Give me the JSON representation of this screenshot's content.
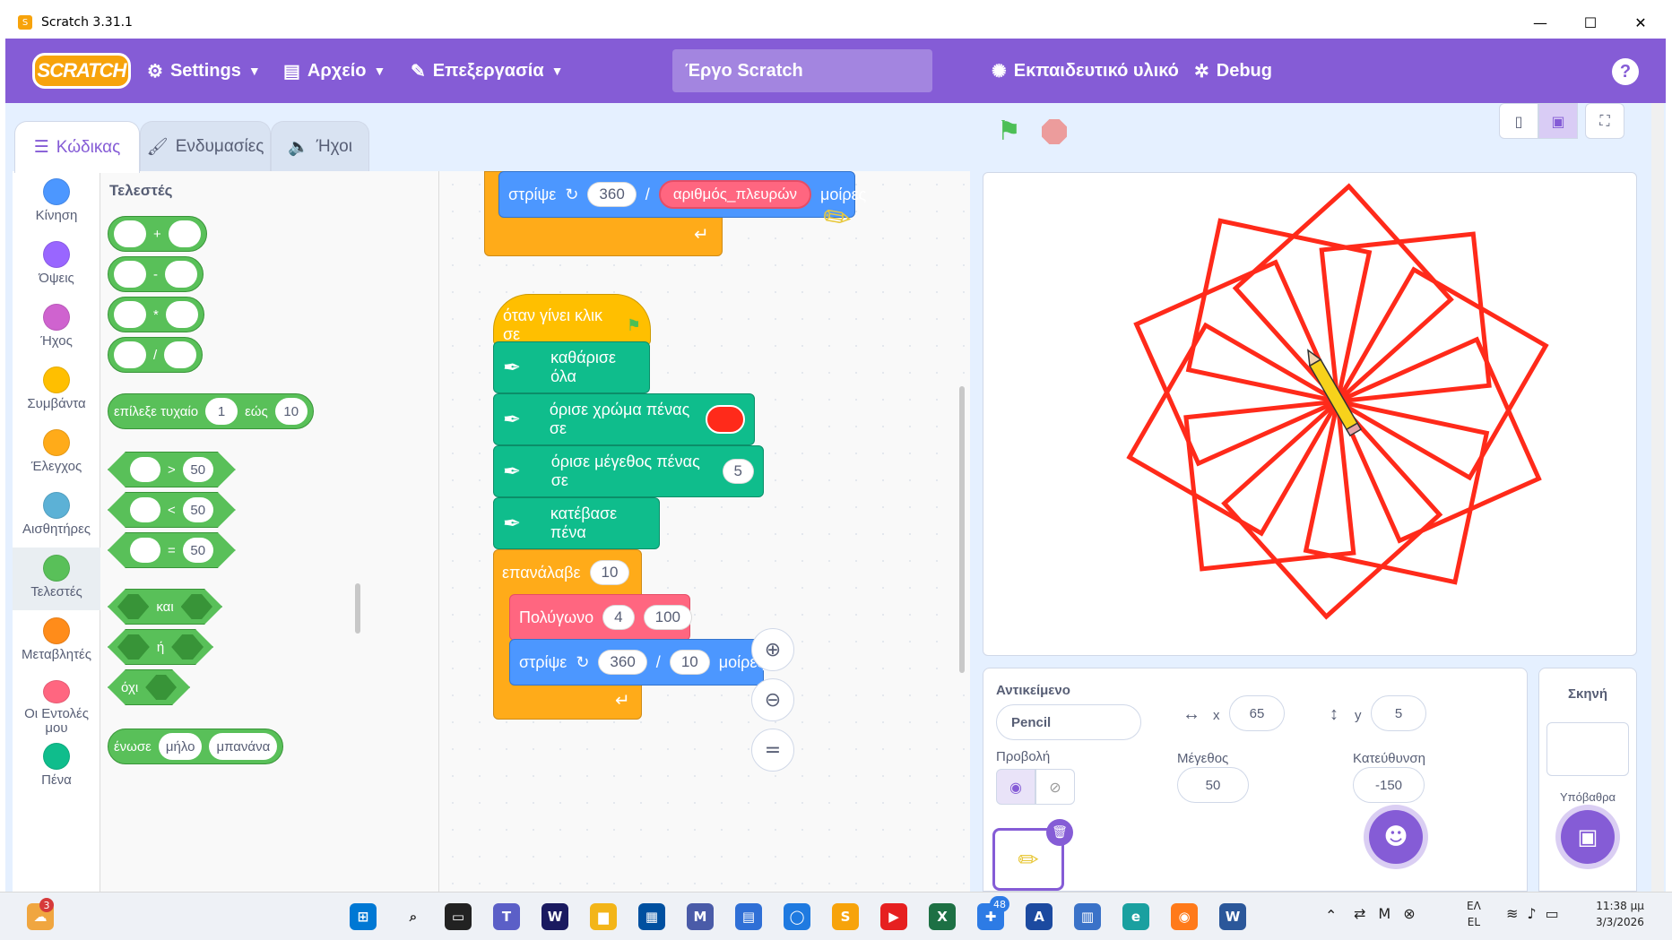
{
  "window": {
    "title": "Scratch 3.31.1"
  },
  "menu": {
    "logo": "SCRATCH",
    "settings": "Settings",
    "file": "Αρχείο",
    "edit": "Επεξεργασία",
    "project_title": "Έργο Scratch",
    "tutorials": "Εκπαιδευτικό υλικό",
    "debug": "Debug",
    "help": "?"
  },
  "tabs": {
    "code": "Κώδικας",
    "costumes": "Ενδυμασίες",
    "sounds": "Ήχοι"
  },
  "categories": [
    {
      "label": "Κίνηση",
      "color": "#4c97ff"
    },
    {
      "label": "Όψεις",
      "color": "#9966ff"
    },
    {
      "label": "Ήχος",
      "color": "#cf63cf"
    },
    {
      "label": "Συμβάντα",
      "color": "#ffbf00"
    },
    {
      "label": "Έλεγχος",
      "color": "#ffab19"
    },
    {
      "label": "Αισθητήρες",
      "color": "#5cb1d6"
    },
    {
      "label": "Τελεστές",
      "color": "#59c059"
    },
    {
      "label": "Μεταβλητές",
      "color": "#ff8c1a"
    },
    {
      "label": "Οι Εντολές μου",
      "color": "#ff6680"
    },
    {
      "label": "Πένα",
      "color": "#0fbd8c"
    }
  ],
  "palette": {
    "heading": "Τελεστές",
    "ops": [
      "+",
      "-",
      "*",
      "/"
    ],
    "random": {
      "label": "επίλεξε τυχαίο",
      "from": "1",
      "to_label": "εώς",
      "to": "10"
    },
    "compare": [
      {
        "op": ">",
        "value": "50"
      },
      {
        "op": "<",
        "value": "50"
      },
      {
        "op": "=",
        "value": "50"
      }
    ],
    "logic": [
      "και",
      "ή",
      "όχι"
    ],
    "join": {
      "label": "ένωσε",
      "a": "μήλο",
      "b": "μπανάνα"
    }
  },
  "script": {
    "top_turn": {
      "label": "στρίψε",
      "a": "360",
      "div": "/",
      "var": "αριθμός_πλευρών",
      "unit": "μοίρες"
    },
    "hat": "όταν γίνει κλικ σε",
    "clear": "καθάρισε όλα",
    "pen_color": "όρισε χρώμα πένας σε",
    "pen_size": {
      "label": "όρισε μέγεθος πένας σε",
      "value": "5"
    },
    "pen_down": "κατέβασε πένα",
    "repeat": {
      "label": "επανάλαβε",
      "value": "10"
    },
    "polygon": {
      "label": "Πολύγωνο",
      "a": "4",
      "b": "100"
    },
    "turn": {
      "label": "στρίψε",
      "a": "360",
      "div": "/",
      "b": "10",
      "unit": "μοίρες"
    }
  },
  "sprite": {
    "label_sprite": "Αντικείμενο",
    "name": "Pencil",
    "x_label": "x",
    "x": "65",
    "y_label": "y",
    "y": "5",
    "show_label": "Προβολή",
    "size_label": "Μέγεθος",
    "size": "50",
    "direction_label": "Κατεύθυνση",
    "direction": "-150"
  },
  "stage_panel": {
    "title": "Σκηνή",
    "backdrops": "Υπόβαθρα"
  },
  "taskbar": {
    "weather_badge": "3",
    "badge_48": "48",
    "lang": "ΕΛ",
    "lang2": "EL",
    "time": "11:38 μμ",
    "date": "3/3/2026"
  },
  "colors": {
    "accent": "#855cd6",
    "operators": "#59c059",
    "pen": "#0fbd8c",
    "control": "#ffab19",
    "events": "#ffbf00",
    "motion": "#4c97ff",
    "myblocks": "#ff6680",
    "drawing": "#ff2a1a"
  }
}
